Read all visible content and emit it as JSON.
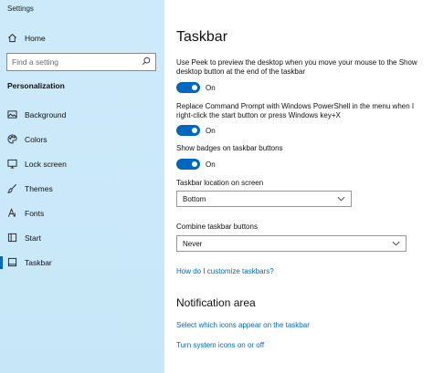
{
  "app": {
    "title": "Settings"
  },
  "sidebar": {
    "home_label": "Home",
    "search_placeholder": "Find a setting",
    "section_label": "Personalization",
    "items": [
      {
        "label": "Background",
        "icon": "picture-icon"
      },
      {
        "label": "Colors",
        "icon": "palette-icon"
      },
      {
        "label": "Lock screen",
        "icon": "lock-screen-icon"
      },
      {
        "label": "Themes",
        "icon": "brush-icon"
      },
      {
        "label": "Fonts",
        "icon": "font-icon"
      },
      {
        "label": "Start",
        "icon": "start-icon"
      },
      {
        "label": "Taskbar",
        "icon": "taskbar-icon",
        "active": true
      }
    ]
  },
  "main": {
    "title": "Taskbar",
    "settings": [
      {
        "text": "Use Peek to preview the desktop when you move your mouse to the Show desktop button at the end of the taskbar",
        "toggle": "On"
      },
      {
        "text": "Replace Command Prompt with Windows PowerShell in the menu when I right-click the start button or press Windows key+X",
        "toggle": "On"
      },
      {
        "text": "Show badges on taskbar buttons",
        "toggle": "On"
      }
    ],
    "location": {
      "label": "Taskbar location on screen",
      "value": "Bottom"
    },
    "combine": {
      "label": "Combine taskbar buttons",
      "value": "Never"
    },
    "help_link": "How do I customize taskbars?",
    "notification": {
      "heading": "Notification area",
      "link1": "Select which icons appear on the taskbar",
      "link2": "Turn system icons on or off"
    }
  },
  "colors": {
    "accent": "#0067c0",
    "sidebar_bg": "#cdeafa"
  }
}
